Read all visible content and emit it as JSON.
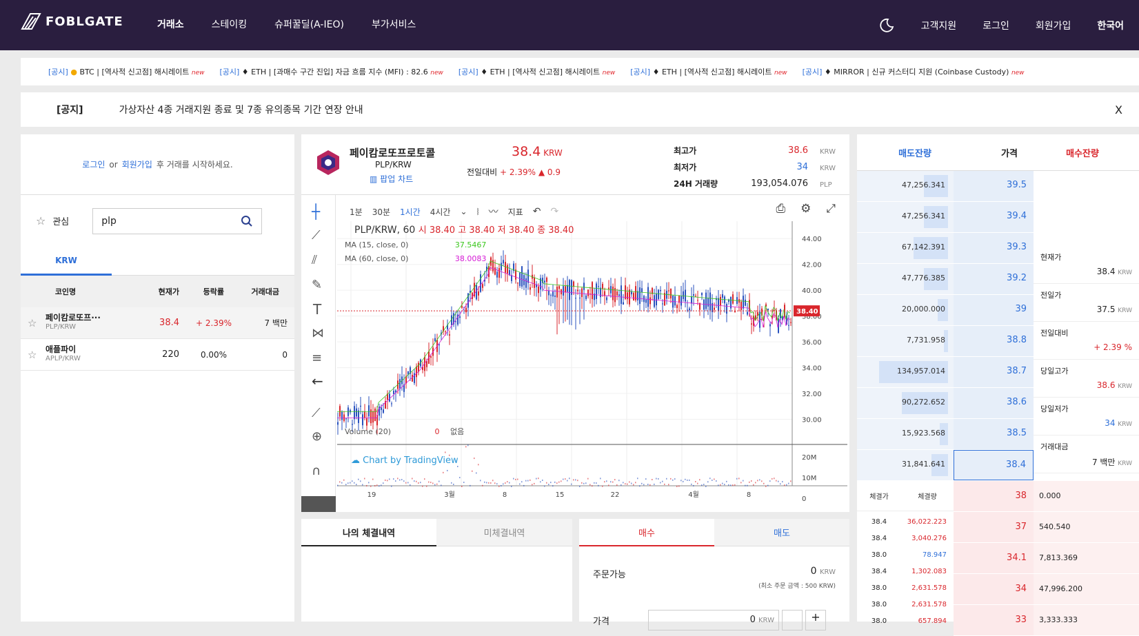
{
  "header": {
    "logo": "FOBLGATE",
    "nav": [
      "거래소",
      "스테이킹",
      "슈퍼꿀딜(A-IEO)",
      "부가서비스"
    ],
    "right": [
      "고객지원",
      "로그인",
      "회원가입",
      "한국어"
    ]
  },
  "ticker": [
    {
      "tag": "[공시]",
      "coin": "BTC",
      "text": "[역사적 신고점] 해시레이트"
    },
    {
      "tag": "[공시]",
      "coin": "ETH",
      "text": "[과매수 구간 진입] 자금 흐름 지수 (MFI) : 82.6"
    },
    {
      "tag": "[공시]",
      "coin": "ETH",
      "text": "[역사적 신고점] 해시레이트"
    },
    {
      "tag": "[공시]",
      "coin": "ETH",
      "text": "[역사적 신고점] 해시레이트"
    },
    {
      "tag": "[공시]",
      "coin": "MIRROR",
      "text": "신규 커스터디 지원 (Coinbase Custody)"
    }
  ],
  "ticker_new": "new",
  "notice": {
    "tag": "[공지]",
    "text": "가상자산 4종 거래지원 종료 및 7종 유의종목 기간 연장 안내",
    "close": "X"
  },
  "left": {
    "login": "로그인",
    "or": "or",
    "signup": "회원가입",
    "login_suffix": "후 거래를 시작하세요.",
    "fav": "관심",
    "search": "plp",
    "tab": "KRW",
    "cols": [
      "코인명",
      "현재가",
      "등락률",
      "거래대금"
    ],
    "rows": [
      {
        "name": "페이캄로또프···",
        "pair": "PLP/KRW",
        "price": "38.4",
        "change": "+ 2.39%",
        "vol": "7 백만"
      },
      {
        "name": "애플파이",
        "pair": "APLP/KRW",
        "price": "220",
        "change": "0.00%",
        "vol": "0"
      }
    ]
  },
  "coin": {
    "name": "페이캄로또프로토콜",
    "pair": "PLP/KRW",
    "popup": "팝업 차트",
    "price": "38.4",
    "unit": "KRW",
    "prev_label": "전일대비",
    "change_pct": "+ 2.39%",
    "change_abs": "0.9",
    "high_label": "최고가",
    "high": "38.6",
    "low_label": "최저가",
    "low": "34",
    "vol_label": "24H 거래량",
    "vol": "193,054.076",
    "vol_unit": "PLP"
  },
  "chart": {
    "intervals": [
      "1분",
      "30분",
      "1시간",
      "4시간"
    ],
    "indicator": "지표",
    "legend": "PLP/KRW, 60",
    "o": "시 38.40",
    "h": "고 38.40",
    "l": "저 38.40",
    "c": "종 38.40",
    "ma1": "MA (15, close, 0)",
    "ma1v": "37.5467",
    "ma2": "MA (60, close, 0)",
    "ma2v": "38.0083",
    "volume": "Volume (20)",
    "volv": "0",
    "none": "없음",
    "brand": "Chart by TradingView",
    "yticks": [
      "44.00",
      "42.00",
      "40.00",
      "38.00",
      "36.00",
      "34.00",
      "32.00",
      "30.00"
    ],
    "vticks": [
      "20M",
      "10M",
      "0"
    ],
    "xticks": [
      "19",
      "3월",
      "8",
      "15",
      "22",
      "4월",
      "8"
    ],
    "last": "38.40"
  },
  "orderbook": {
    "cols": [
      "매도잔량",
      "가격",
      "매수잔량"
    ],
    "asks": [
      {
        "q": "47,256.341",
        "p": "39.5"
      },
      {
        "q": "47,256.341",
        "p": "39.4"
      },
      {
        "q": "67,142.391",
        "p": "39.3"
      },
      {
        "q": "47,776.385",
        "p": "39.2"
      },
      {
        "q": "20,000.000",
        "p": "39"
      },
      {
        "q": "7,731.958",
        "p": "38.8"
      },
      {
        "q": "134,957.014",
        "p": "38.7"
      },
      {
        "q": "90,272.652",
        "p": "38.6"
      },
      {
        "q": "15,923.568",
        "p": "38.5"
      },
      {
        "q": "31,841.641",
        "p": "38.4"
      }
    ],
    "info": [
      {
        "l": "현재가",
        "v": "38.4",
        "u": "KRW"
      },
      {
        "l": "전일가",
        "v": "37.5",
        "u": "KRW"
      },
      {
        "l": "전일대비",
        "v": "+ 2.39 %",
        "u": ""
      },
      {
        "l": "당일고가",
        "v": "38.6",
        "u": "KRW"
      },
      {
        "l": "당일저가",
        "v": "34",
        "u": "KRW"
      },
      {
        "l": "거래대금",
        "v": "7 백만",
        "u": "KRW"
      }
    ],
    "trade_cols": [
      "체결가",
      "체결량"
    ],
    "trades": [
      {
        "p": "38.4",
        "q": "36,022.223"
      },
      {
        "p": "38.4",
        "q": "3,040.276"
      },
      {
        "p": "38.0",
        "q": "78.947"
      },
      {
        "p": "38.4",
        "q": "1,302.083"
      },
      {
        "p": "38.0",
        "q": "2,631.578"
      },
      {
        "p": "38.0",
        "q": "2,631.578"
      },
      {
        "p": "38.0",
        "q": "657.894"
      }
    ],
    "bids": [
      {
        "p": "38",
        "q": "0.000"
      },
      {
        "p": "37",
        "q": "540.540"
      },
      {
        "p": "34.1",
        "q": "7,813.369"
      },
      {
        "p": "34",
        "q": "47,996.200"
      },
      {
        "p": "33",
        "q": "3,333.333"
      }
    ]
  },
  "history": {
    "tab1": "나의 체결내역",
    "tab2": "미체결내역"
  },
  "order": {
    "buy": "매수",
    "sell": "매도",
    "avail": "주문가능",
    "avail_v": "0",
    "unit": "KRW",
    "min": "(최소 주문 금액 : 500 KRW)",
    "price": "가격",
    "pv": "0"
  }
}
